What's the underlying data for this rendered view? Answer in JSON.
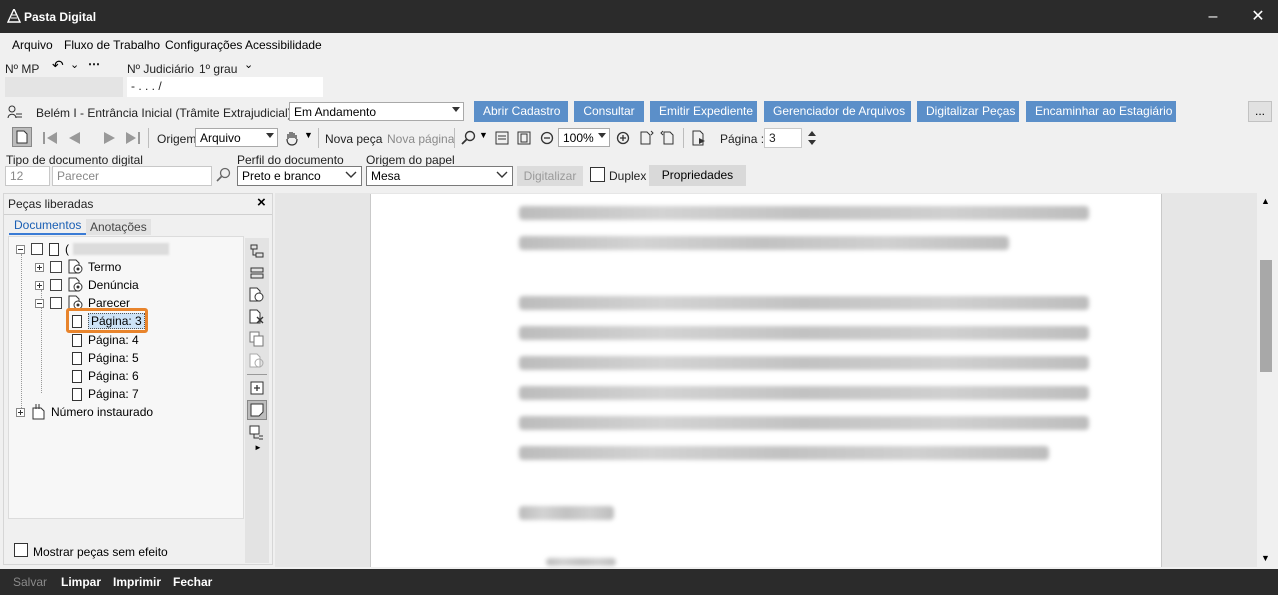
{
  "window": {
    "title": "Pasta Digital"
  },
  "menu": [
    "Arquivo",
    "Fluxo de Trabalho",
    "Configurações",
    "Acessibilidade"
  ],
  "header": {
    "mp_label": "Nº MP",
    "judicial_label": "Nº Judiciário",
    "grau": "1º grau",
    "judicial_value": "-    .    .    .    /"
  },
  "fila": {
    "prefix": "Belém I - Entrância Inicial (Trâmite Extrajudicial) - Fila",
    "selected": "Em Andamento"
  },
  "actions": [
    "Abrir Cadastro",
    "Consultar",
    "Emitir Expediente",
    "Gerenciador de Arquivos",
    "Digitalizar Peças",
    "Encaminhar ao Estagiário"
  ],
  "more_button": "...",
  "toolbar": {
    "origem_label": "Origem",
    "origem_value": "Arquivo",
    "nova_peca": "Nova peça",
    "nova_pagina": "Nova página",
    "zoom": "100%",
    "pagina_label": "Página :",
    "pagina_value": "3"
  },
  "scan": {
    "tipo_label": "Tipo de documento digital",
    "tipo_code": "12",
    "tipo_placeholder": "Parecer",
    "perfil_label": "Perfil do documento",
    "perfil_value": "Preto e branco",
    "origem_papel_label": "Origem do papel",
    "origem_papel_value": "Mesa",
    "digitalizar": "Digitalizar",
    "duplex": "Duplex",
    "propriedades": "Propriedades"
  },
  "left_panel": {
    "title": "Peças liberadas",
    "close": "×",
    "tabs": [
      "Documentos",
      "Anotações"
    ],
    "tree": {
      "root_label": "(",
      "items": [
        "Termo",
        "Denúncia",
        "Parecer"
      ],
      "pages": [
        "Página: 3",
        "Página: 4",
        "Página: 5",
        "Página: 6",
        "Página: 7"
      ],
      "numero": "Número instaurado"
    },
    "mostrar": "Mostrar peças sem efeito"
  },
  "status": {
    "salvar": "Salvar",
    "limpar": "Limpar",
    "imprimir": "Imprimir",
    "fechar": "Fechar"
  },
  "colors": {
    "titlebar": "#2b2b2b",
    "accent": "#5b8fc9",
    "highlight": "#e8842c"
  }
}
